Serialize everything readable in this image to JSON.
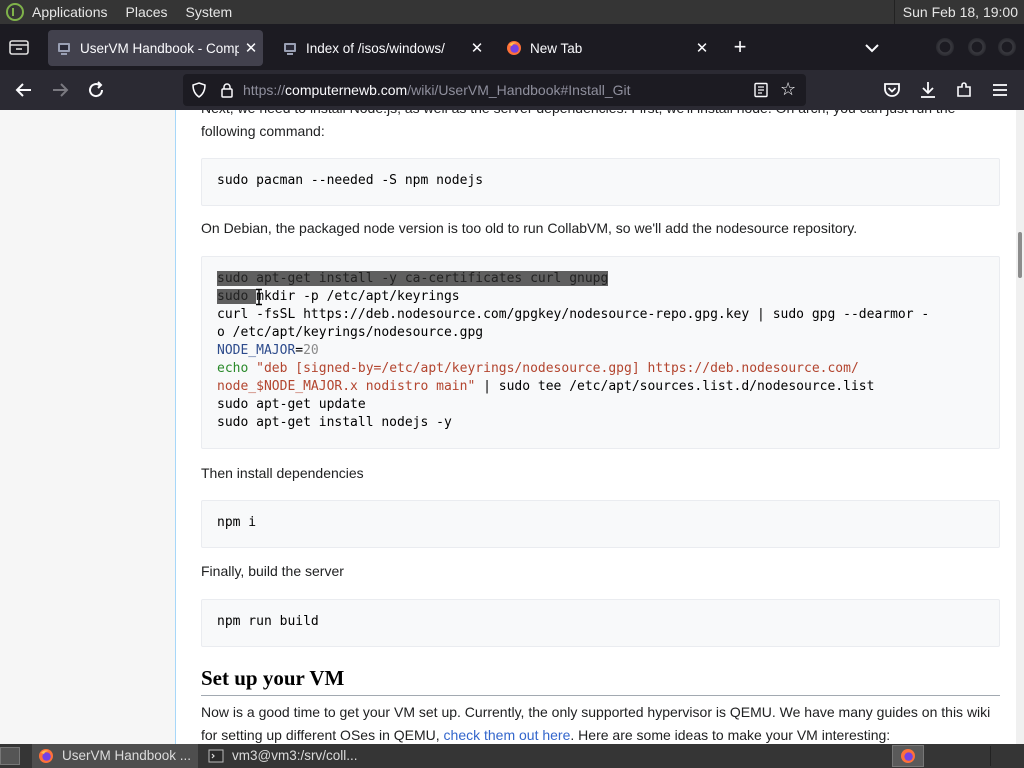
{
  "top_panel": {
    "menus": [
      "Applications",
      "Places",
      "System"
    ],
    "clock": "Sun Feb 18, 19:00"
  },
  "tabs": [
    {
      "label": "UserVM Handbook - Compu",
      "icon": "uservm-favicon",
      "active": true
    },
    {
      "label": "Index of /isos/windows/",
      "icon": "uservm-favicon",
      "active": false
    },
    {
      "label": "New Tab",
      "icon": "firefox-icon",
      "active": false
    }
  ],
  "urlbar": {
    "scheme": "https://",
    "domain": "computernewb.com",
    "path": "/wiki/UserVM_Handbook#Install_Git"
  },
  "page": {
    "intro_para": "Next, we need to install Node.js, as well as the server dependencies. First, we'll install node. On arch, you can just run the following command:",
    "code_arch": "sudo pacman --needed -S npm nodejs",
    "debian_para": "On Debian, the packaged node version is too old to run CollabVM, so we'll add the nodesource repository.",
    "code_debian": {
      "line1": "sudo apt-get install -y ca-certificates curl gnupg",
      "line2_selected": "sudo ",
      "line2_rest": "mkdir -p /etc/apt/keyrings",
      "line3a": "curl -fsSL https://deb.nodesource.com/gpgkey/nodesource-repo.gpg.key | sudo gpg --dearmor -",
      "line3b": "o /etc/apt/keyrings/nodesource.gpg",
      "line4_var": "NODE_MAJOR",
      "line4_eq": "=",
      "line4_num": "20",
      "line5_echo": "echo",
      "line5_str": " \"deb [signed-by=/etc/apt/keyrings/nodesource.gpg] https://deb.nodesource.com/",
      "line6_str": "node_$NODE_MAJOR.x nodistro main\"",
      "line6_rest": " | sudo tee /etc/apt/sources.list.d/nodesource.list",
      "line7": "sudo apt-get update",
      "line8": "sudo apt-get install nodejs -y"
    },
    "deps_para": "Then install dependencies",
    "code_deps": "npm i",
    "build_para": "Finally, build the server",
    "code_build": "npm run build",
    "heading_vm": "Set up your VM",
    "vm_para_a": "Now is a good time to get your VM set up. Currently, the only supported hypervisor is QEMU. We have many guides on this wiki for setting up different OSes in QEMU, ",
    "vm_link": "check them out here",
    "vm_para_b": ". Here are some ideas to make your VM interesting:"
  },
  "taskbar": {
    "items": [
      {
        "label": "UserVM Handbook ...",
        "icon": "firefox-icon",
        "active": true
      },
      {
        "label": "vm3@vm3:/srv/coll...",
        "icon": "terminal-icon",
        "active": false
      }
    ]
  },
  "colors": {
    "accent_link": "#3366cc",
    "tab_strip": "#1c1b22",
    "nav_bar": "#2b2a33",
    "selection": "#5f5f5f"
  }
}
